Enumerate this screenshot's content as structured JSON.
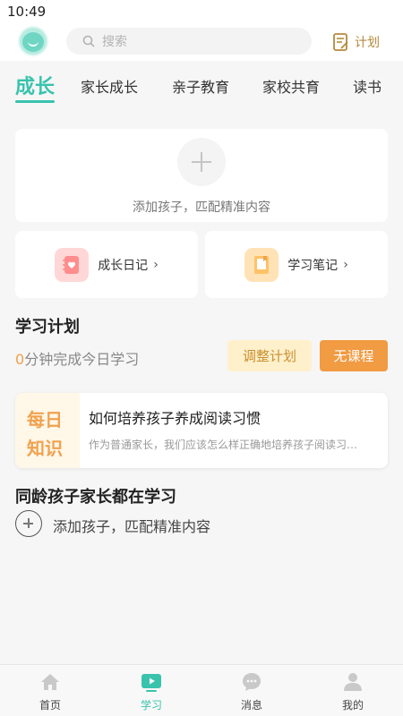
{
  "status_bar": {
    "time": "10:49"
  },
  "header": {
    "search_placeholder": "搜索",
    "plan_label": "计划"
  },
  "tabs": [
    {
      "label": "成长",
      "active": true
    },
    {
      "label": "家长成长"
    },
    {
      "label": "亲子教育"
    },
    {
      "label": "家校共育"
    },
    {
      "label": "读书"
    }
  ],
  "add_child_card": {
    "text": "添加孩子，匹配精准内容"
  },
  "tiles": [
    {
      "label": "成长日记",
      "icon": "diary-icon"
    },
    {
      "label": "学习笔记",
      "icon": "notebook-icon"
    }
  ],
  "study_plan": {
    "title": "学习计划",
    "minutes": "0",
    "minutes_suffix": "分钟完成今日学习",
    "adjust_button": "调整计划",
    "no_course_button": "无课程"
  },
  "daily_knowledge": {
    "badge_line1": "每日",
    "badge_line2": "知识",
    "title": "如何培养孩子养成阅读习惯",
    "description": "作为普通家长，我们应该怎么样正确地培养孩子阅读习惯呢"
  },
  "peers": {
    "title": "同龄孩子家长都在学习",
    "add_text": "添加孩子，匹配精准内容"
  },
  "bottom_nav": [
    {
      "label": "首页",
      "icon": "home-icon"
    },
    {
      "label": "学习",
      "icon": "play-icon",
      "active": true
    },
    {
      "label": "消息",
      "icon": "chat-icon"
    },
    {
      "label": "我的",
      "icon": "user-icon"
    }
  ],
  "colors": {
    "accent": "#39c3ad",
    "orange": "#f19b42",
    "gold": "#b58a3c"
  }
}
